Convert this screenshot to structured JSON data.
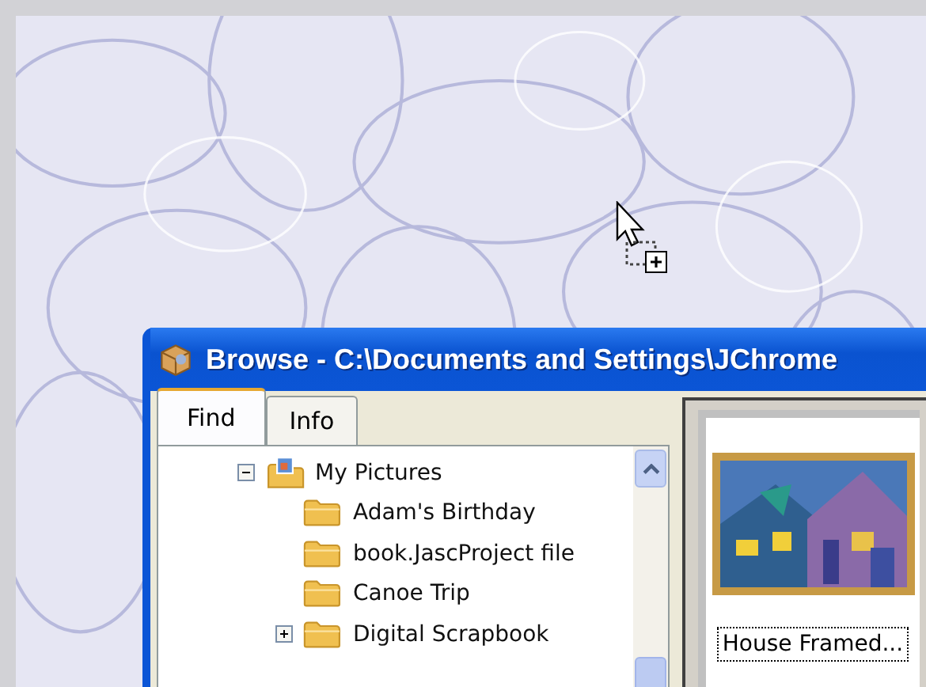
{
  "window": {
    "title": "Browse - C:\\Documents and Settings\\JChrome"
  },
  "tabs": [
    {
      "label": "Find",
      "selected": true
    },
    {
      "label": "Info",
      "selected": false
    }
  ],
  "tree": [
    {
      "label": "My Pictures",
      "kind": "branch",
      "expanded": true,
      "children": [
        {
          "label": "Adam's Birthday",
          "kind": "leaf"
        },
        {
          "label": "book.JascProject file",
          "kind": "leaf"
        },
        {
          "label": "Canoe Trip",
          "kind": "leaf"
        },
        {
          "label": "Digital Scrapbook",
          "kind": "branch",
          "expanded": false
        }
      ]
    }
  ],
  "thumbnails": [
    {
      "caption": "House Framed...",
      "focused": true
    }
  ]
}
